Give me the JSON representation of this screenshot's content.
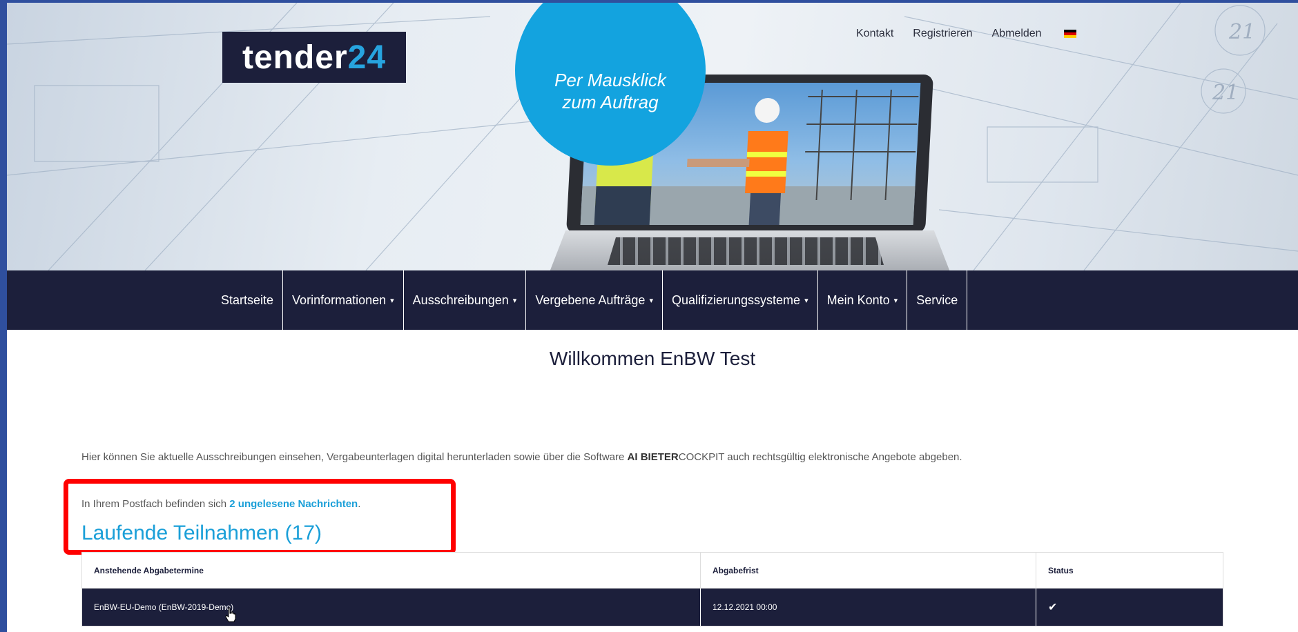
{
  "header": {
    "logo": {
      "part1": "tender",
      "part2": "24"
    },
    "slogan": "Per Mausklick zum Auftrag",
    "top_links": [
      "Kontakt",
      "Registrieren",
      "Abmelden"
    ],
    "language_flag": "german-flag-icon"
  },
  "nav": {
    "items": [
      {
        "label": "Startseite",
        "dropdown": false
      },
      {
        "label": "Vorinformationen",
        "dropdown": true
      },
      {
        "label": "Ausschreibungen",
        "dropdown": true
      },
      {
        "label": "Vergebene Aufträge",
        "dropdown": true
      },
      {
        "label": "Qualifizierungssysteme",
        "dropdown": true
      },
      {
        "label": "Mein Konto",
        "dropdown": true
      },
      {
        "label": "Service",
        "dropdown": false
      }
    ]
  },
  "main": {
    "welcome": "Willkommen EnBW Test",
    "intro_before": "Hier können Sie aktuelle Ausschreibungen einsehen, Vergabeunterlagen digital herunterladen sowie über die Software ",
    "intro_bold": "AI BIETER",
    "intro_after": "COCKPIT auch rechtsgültig elektronische Angebote abgeben.",
    "message_before": "In Ihrem Postfach befinden sich ",
    "message_link": "2 ungelesene Nachrichten",
    "message_after": ".",
    "section_title": "Laufende Teilnahmen (17)"
  },
  "table": {
    "headers": [
      "Anstehende Abgabetermine",
      "Abgabefrist",
      "Status"
    ],
    "rows": [
      {
        "name": "EnBW-EU-Demo (EnBW-2019-Demo)",
        "deadline": "12.12.2021 00:00",
        "status": "✔"
      }
    ]
  },
  "colors": {
    "navy": "#1c1f3b",
    "accent_blue": "#1a9fd8",
    "highlight_red": "#ff0000"
  }
}
